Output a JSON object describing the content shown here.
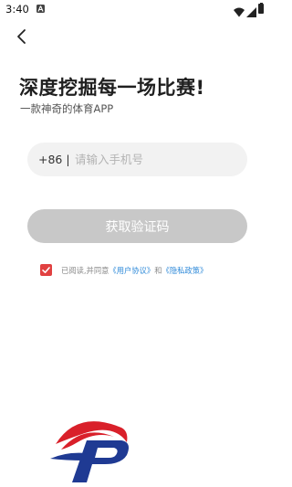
{
  "status_bar": {
    "time": "3:40",
    "notification_icon": "a-letter-icon",
    "wifi_icon": "wifi-icon",
    "signal_icon": "signal-icon",
    "battery_icon": "battery-icon"
  },
  "nav": {
    "back_icon": "chevron-left-icon"
  },
  "header": {
    "title": "深度挖掘每一场比赛!",
    "subtitle": "一款神奇的体育APP"
  },
  "phone_field": {
    "country_code": "+86 |",
    "placeholder": "请输入手机号",
    "value": ""
  },
  "get_code_button": {
    "label": "获取验证码"
  },
  "agreement": {
    "checked": true,
    "prefix": "已阅读,并同意",
    "user_agreement": "《用户协议》",
    "conjunction": "和",
    "privacy_policy": "《隐私政策》"
  },
  "colors": {
    "accent_red": "#e14141",
    "link_blue": "#2f8ad9",
    "button_disabled": "#c8c8c8",
    "input_bg": "#f2f2f2",
    "logo_red": "#d9202a",
    "logo_blue": "#1f3a93"
  }
}
